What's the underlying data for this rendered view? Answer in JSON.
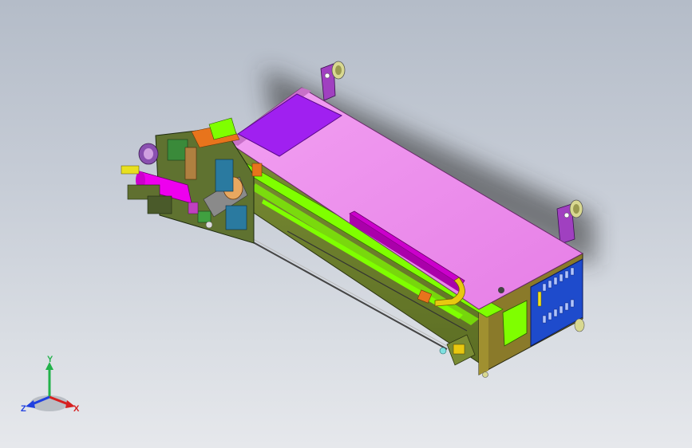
{
  "viewport": {
    "background_top": "#b4bcc8",
    "background_bottom": "#e6e8ec"
  },
  "model": {
    "colors": {
      "top_panel": "#ee82ee",
      "top_panel_window": "#a020f0",
      "front_face": "#6b7d2e",
      "side_face": "#556b2f",
      "green_rail": "#7fff00",
      "magenta_bar": "#cc00cc",
      "blue_panel": "#1e4bcc",
      "bracket": "#a040c0",
      "wheel": "#d8d890",
      "orange_block": "#e8741c",
      "yellow_block": "#e8c810",
      "end_face": "#8a7a2a"
    }
  },
  "triad": {
    "y_label": "Y",
    "x_label": "X",
    "z_label": "Z",
    "y_color": "#22b24a",
    "x_color": "#d62020",
    "z_color": "#2040e0"
  }
}
